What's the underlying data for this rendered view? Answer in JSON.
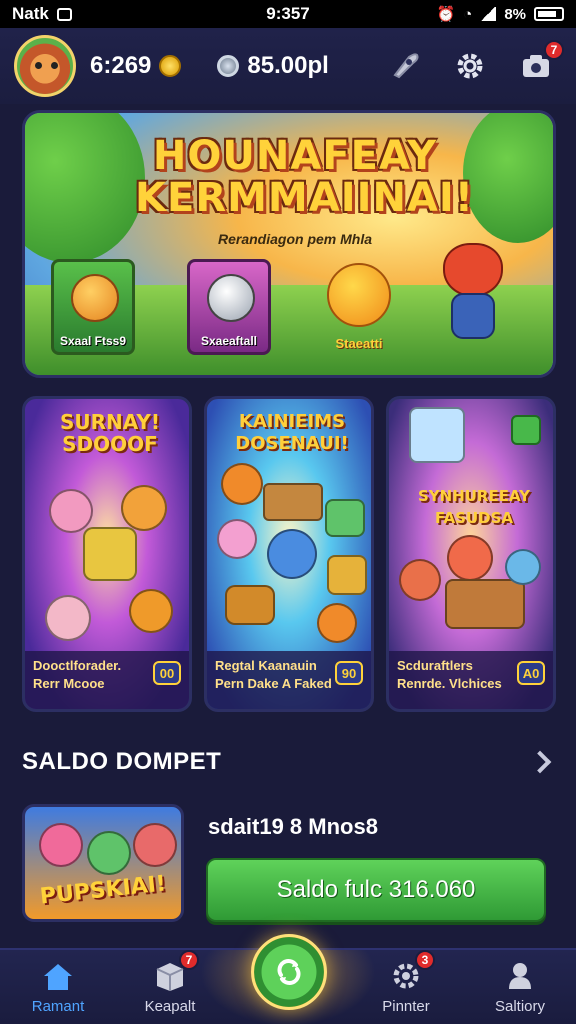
{
  "status_bar": {
    "carrier": "Natk",
    "time": "9:357",
    "battery": "8%"
  },
  "header": {
    "coins": "6:269",
    "gems": "85.00pl",
    "settings_badge": "",
    "camera_badge": "7"
  },
  "hero": {
    "title_line1": "HOUNAFEAY",
    "title_line2": "KERMMAIINAI!",
    "subtitle": "Rerandiagon pem Mhla",
    "cards": [
      {
        "label": "Sxaal Ftss9"
      },
      {
        "label": "Sxaeaftall"
      },
      {
        "label": "Staeatti"
      }
    ]
  },
  "games": [
    {
      "title_line1": "SURNAY!",
      "title_line2": "SDOOOF",
      "footer_line1": "Dooctlforader.",
      "footer_line2": "Rerr Mcooe",
      "badge": "00"
    },
    {
      "title_line1": "KAINIEIMS",
      "title_line2": "DOSENAUI!",
      "footer_line1": "Regtal Kaanauin",
      "footer_line2": "Pern Dake A Faked",
      "badge": "90"
    },
    {
      "title_line1": "SYNHUREEAY",
      "title_line2": "FASUDSA",
      "footer_line1": "Scduraftlers",
      "footer_line2": "Renrde. Vlchices",
      "badge": "A0"
    }
  ],
  "wallet": {
    "title": "SALDO DOMPET",
    "thumb_label": "PUPSKIAI!",
    "info": "sdait19 8 Mnos8",
    "button_label": "Saldo fulc 316.060"
  },
  "bottom_nav": {
    "items": [
      {
        "label": "Ramant"
      },
      {
        "label": "Keapalt",
        "badge": "7"
      },
      {
        "label": "Pinnter",
        "badge": "3"
      },
      {
        "label": "Saltiory"
      }
    ]
  },
  "colors": {
    "background": "#1a1b3a",
    "accent_green": "#3fae3f",
    "accent_gold": "#ffd23a",
    "nav_active": "#4fa4ff",
    "badge_red": "#e02b2b"
  }
}
